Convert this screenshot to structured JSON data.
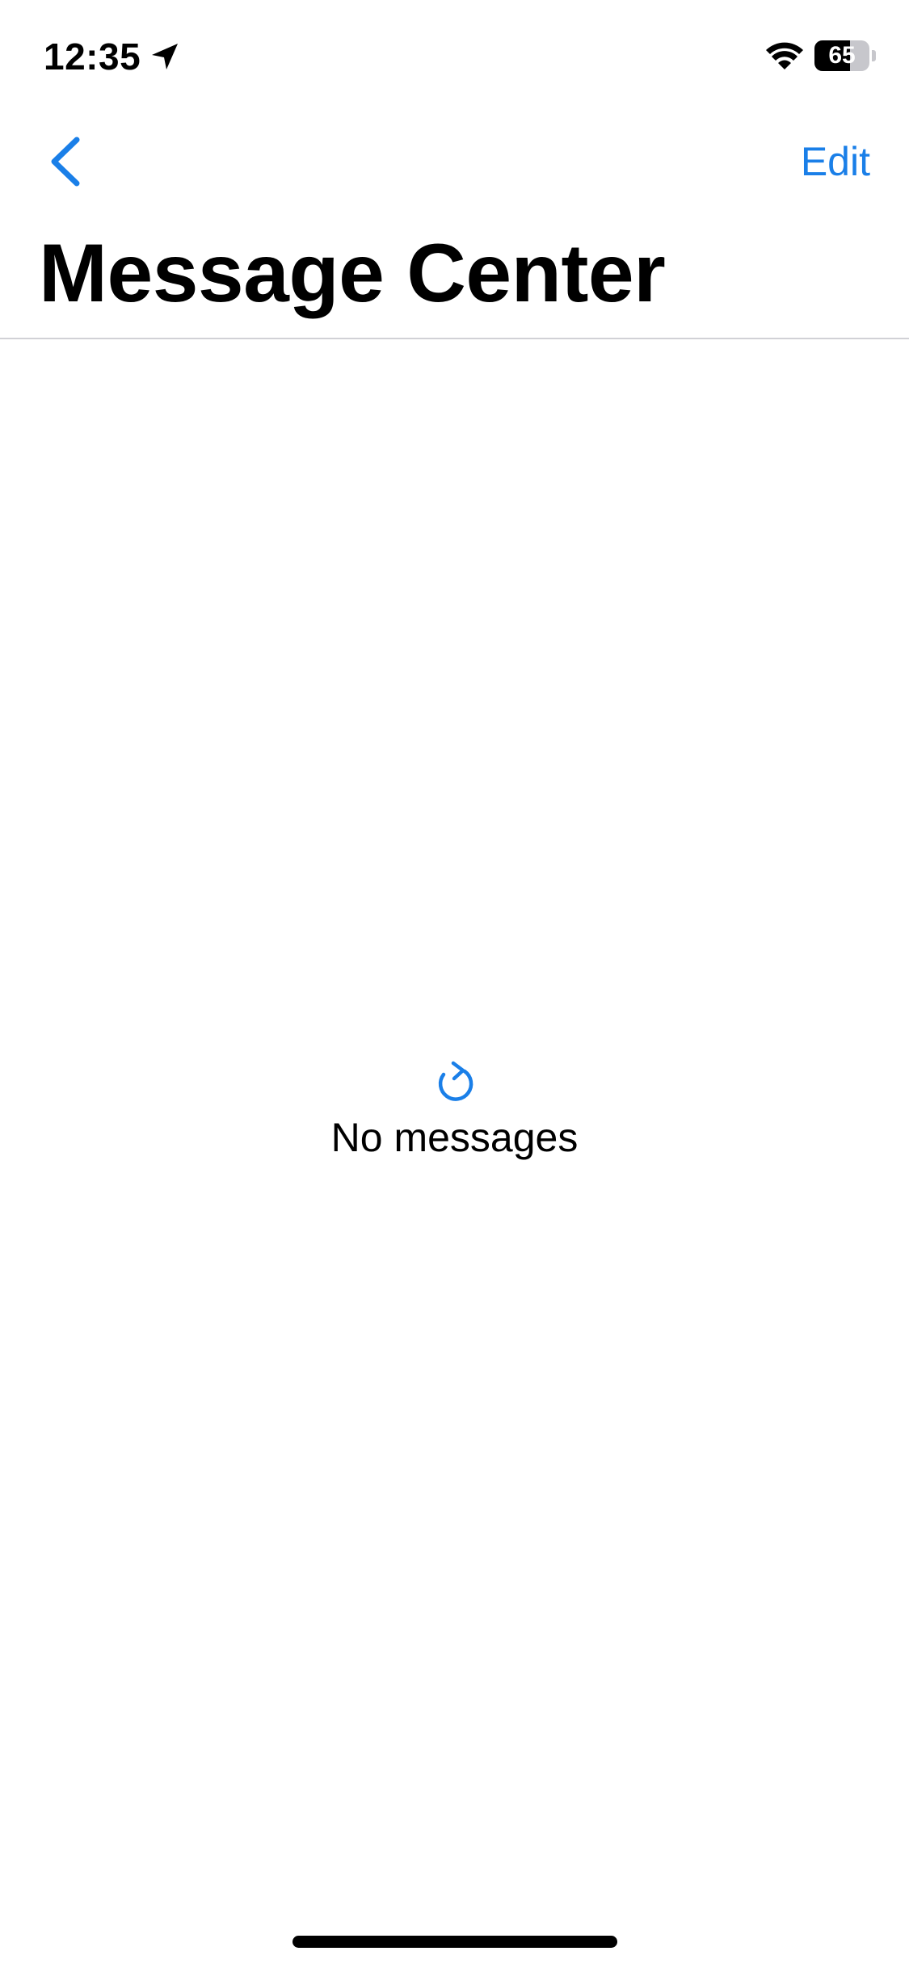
{
  "status_bar": {
    "time": "12:35",
    "battery_level": "65",
    "battery_percent": 65,
    "location_icon": "location-arrow-icon",
    "wifi_icon": "wifi-icon"
  },
  "nav": {
    "back_icon": "chevron-left-icon",
    "edit_label": "Edit"
  },
  "header": {
    "title": "Message Center"
  },
  "empty_state": {
    "icon": "refresh-icon",
    "text": "No messages"
  },
  "colors": {
    "accent": "#1a7fe8",
    "text": "#000000",
    "background": "#ffffff",
    "divider": "#d1d1d6"
  }
}
